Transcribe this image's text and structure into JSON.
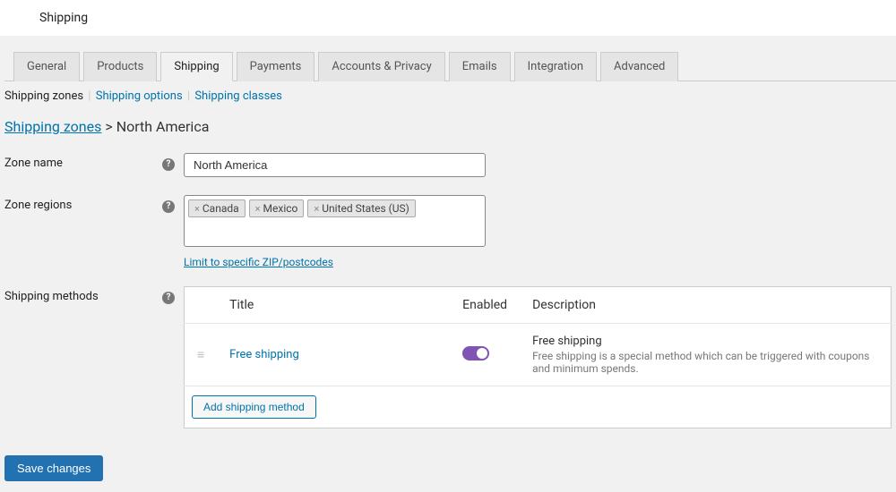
{
  "header": {
    "title": "Shipping"
  },
  "tabs": {
    "items": [
      {
        "label": "General"
      },
      {
        "label": "Products"
      },
      {
        "label": "Shipping"
      },
      {
        "label": "Payments"
      },
      {
        "label": "Accounts & Privacy"
      },
      {
        "label": "Emails"
      },
      {
        "label": "Integration"
      },
      {
        "label": "Advanced"
      }
    ]
  },
  "subtabs": {
    "zones": "Shipping zones",
    "options": "Shipping options",
    "classes": "Shipping classes"
  },
  "breadcrumb": {
    "root": "Shipping zones",
    "sep": ">",
    "current": "North America"
  },
  "form": {
    "zone_name_label": "Zone name",
    "zone_name_value": "North America",
    "zone_regions_label": "Zone regions",
    "regions": [
      "Canada",
      "Mexico",
      "United States (US)"
    ],
    "zip_link": "Limit to specific ZIP/postcodes",
    "methods_label": "Shipping methods"
  },
  "methods_table": {
    "headers": {
      "title": "Title",
      "enabled": "Enabled",
      "description": "Description"
    },
    "rows": [
      {
        "title": "Free shipping",
        "desc_main": "Free shipping",
        "desc_sub": "Free shipping is a special method which can be triggered with coupons and minimum spends."
      }
    ],
    "add_button": "Add shipping method"
  },
  "save_button": "Save changes"
}
